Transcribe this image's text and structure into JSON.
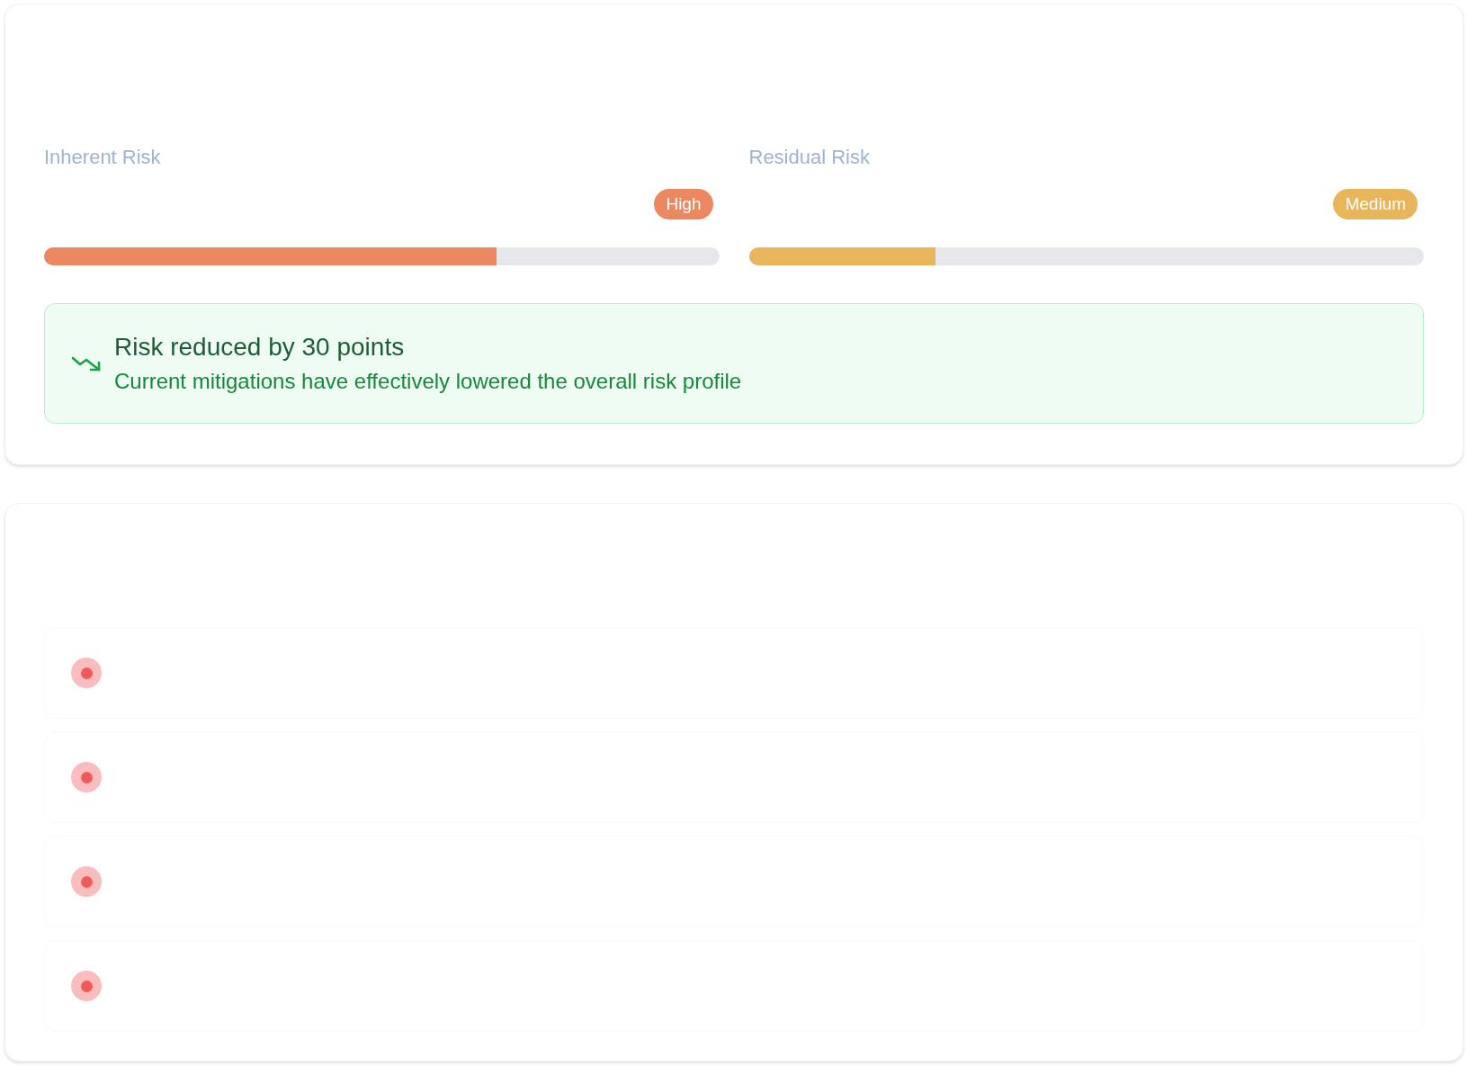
{
  "risk_levels": [
    {
      "label": "Inherent Risk",
      "badge": "High",
      "level": 0.67,
      "color": "#eb8860"
    },
    {
      "label": "Residual Risk",
      "badge": "Medium",
      "level": 0.277,
      "color": "#e8b55a"
    }
  ],
  "summary": {
    "title": "Risk reduced by 30 points",
    "text": "Current mitigations have effectively lowered the overall risk profile"
  },
  "risk_items": [
    {
      "color": "#ef5b5b"
    },
    {
      "color": "#ef5b5b"
    },
    {
      "color": "#ef5b5b"
    },
    {
      "color": "#ef5b5b"
    }
  ]
}
